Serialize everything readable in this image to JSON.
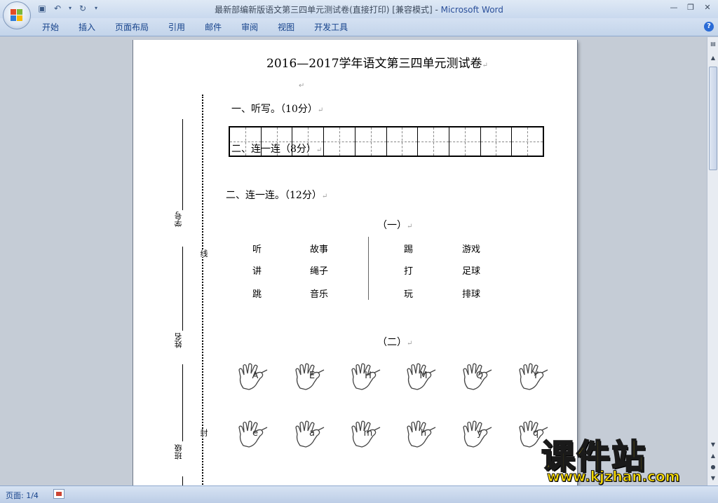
{
  "window": {
    "title_doc": "最新部编新版语文第三四单元测试卷(直接打印) [兼容模式]",
    "title_sep": " - ",
    "title_app": "Microsoft Word"
  },
  "ribbon": {
    "tabs": [
      "开始",
      "插入",
      "页面布局",
      "引用",
      "邮件",
      "审阅",
      "视图",
      "开发工具"
    ]
  },
  "document": {
    "title": "2016—2017学年语文第三四单元测试卷",
    "q1": "一、听写。（10分）",
    "grid_overlay": "二、连一连（8分）",
    "q2": "二、连一连。（12分）",
    "sub1": "（一）",
    "sub2": "（二）",
    "match_left": [
      [
        "听",
        "故事"
      ],
      [
        "讲",
        "绳子"
      ],
      [
        "跳",
        "音乐"
      ]
    ],
    "match_right": [
      [
        "踢",
        "游戏"
      ],
      [
        "打",
        "足球"
      ],
      [
        "玩",
        "排球"
      ]
    ],
    "para_mark": "↵",
    "binding": {
      "student_no": "学号",
      "name": "姓名",
      "class": "班级",
      "line_char": "线",
      "seal_char": "封"
    },
    "uppercase_letters": [
      "A",
      "E",
      "H",
      "M",
      "Q",
      "Y"
    ],
    "lowercase_letters": [
      "e",
      "a",
      "m",
      "h",
      "y",
      "q"
    ]
  },
  "status": {
    "page": "页面: 1/4"
  },
  "watermark": {
    "text": "课件站",
    "url": "www.kjzhan.com"
  }
}
